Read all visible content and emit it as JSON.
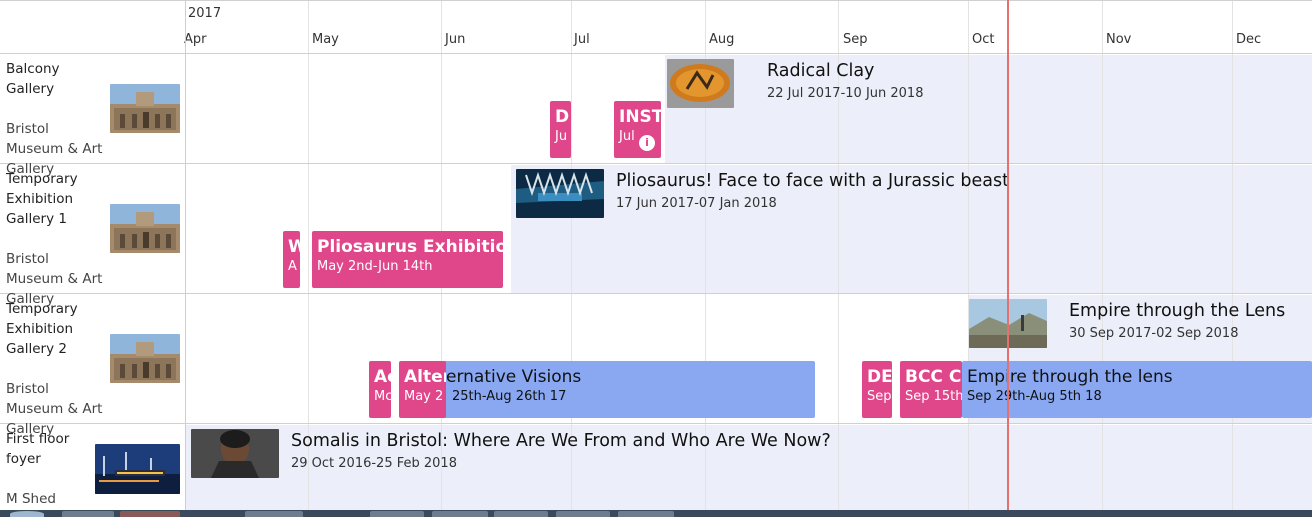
{
  "header": {
    "year": "2017",
    "months": [
      "Apr",
      "May",
      "Jun",
      "Jul",
      "Aug",
      "Sep",
      "Oct",
      "Nov",
      "Dec"
    ]
  },
  "rows": [
    {
      "name": "Balcony Gallery",
      "venue": "Bristol Museum & Art Gallery"
    },
    {
      "name": "Temporary Exhibition Gallery 1",
      "venue": "Bristol Museum & Art Gallery"
    },
    {
      "name": "Temporary Exhibition Gallery 2",
      "venue": "Bristol Museum & Art Gallery"
    },
    {
      "name": "First floor foyer",
      "venue": "M Shed"
    }
  ],
  "exhibitions": {
    "radical_clay": {
      "title": "Radical Clay",
      "dates": "22 Jul 2017-10 Jun 2018"
    },
    "pliosaurus": {
      "title": "Pliosaurus! Face to face with a Jurassic beast",
      "dates": "17 Jun 2017-07 Jan 2018"
    },
    "empire": {
      "title": "Empire through the Lens",
      "dates": "30 Sep 2017-02 Sep 2018"
    },
    "somalis": {
      "title": "Somalis in Bristol: Where Are We From and Who Are We Now?",
      "dates": "29 Oct 2016-25 Feb 2018"
    }
  },
  "events": {
    "d": {
      "title": "D",
      "date": "Ju"
    },
    "insta": {
      "title": "INSTA",
      "date": "Jul"
    },
    "w": {
      "title": "W",
      "date": "A"
    },
    "plio_exh": {
      "title": "Pliosaurus Exhibition",
      "date": "May 2nd-Jun 14th"
    },
    "a": {
      "title": "Ac",
      "date": "Mc"
    },
    "alter": {
      "title": "Alter",
      "date": "May 2"
    },
    "alt_visions": {
      "title": "ernative Visions",
      "date": "25th-Aug 26th 17"
    },
    "de": {
      "title": "DE",
      "date": "Sep"
    },
    "bcc": {
      "title": "BCC C",
      "date": "Sep 15th"
    },
    "empire_lens": {
      "title": "Empire through the lens",
      "date": "Sep 29th-Aug 5th 18"
    }
  },
  "colors": {
    "event_pink": "#e0478a",
    "event_blue": "#8aa8f2",
    "band": "#eceff9",
    "now_line": "#e5706e"
  }
}
